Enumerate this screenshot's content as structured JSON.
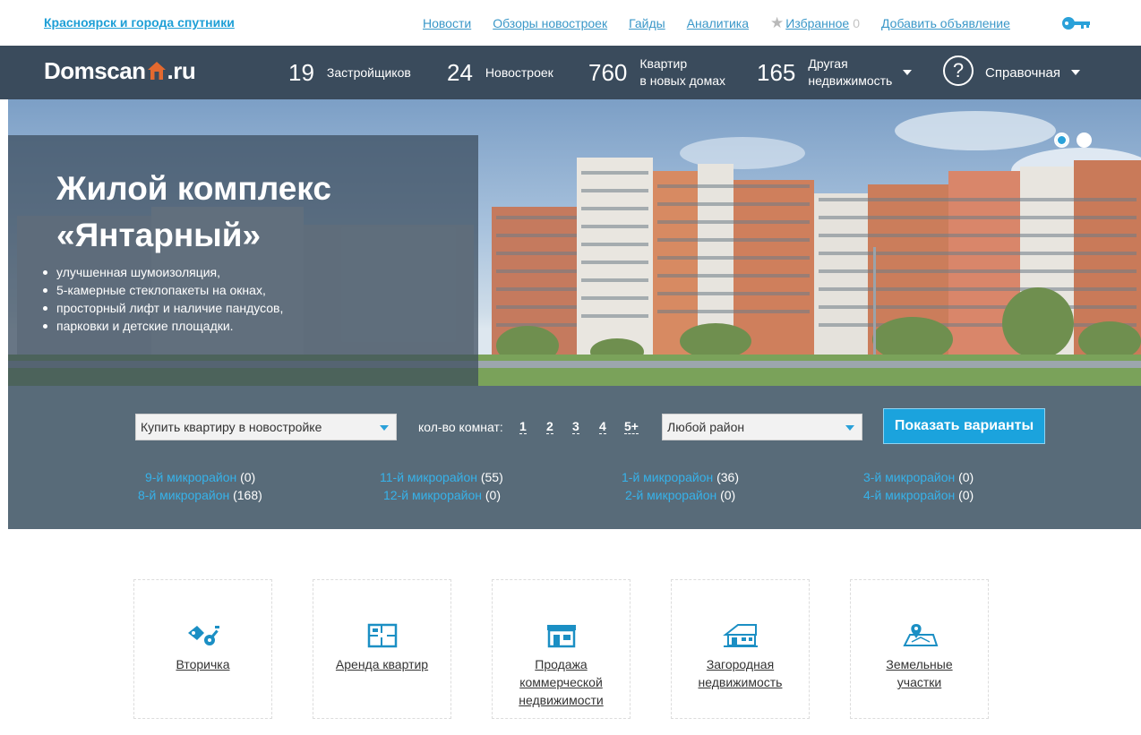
{
  "topbar": {
    "city": "Красноярск и города спутники",
    "nav": [
      "Новости",
      "Обзоры новостроек",
      "Гайды",
      "Аналитика"
    ],
    "favorites_label": "Избранное",
    "favorites_count": "0",
    "add_listing": "Добавить объявление"
  },
  "header": {
    "logo_left": "Domscan",
    "logo_right": ".ru",
    "stats": [
      {
        "num": "19",
        "label": "Застройщиков"
      },
      {
        "num": "24",
        "label": "Новостроек"
      },
      {
        "num": "760",
        "label_line1": "Квартир",
        "label_line2": "в новых домах"
      },
      {
        "num": "165",
        "label_line1": "Другая",
        "label_line2": "недвижимость"
      }
    ],
    "help_symbol": "?",
    "help_label": "Справочная"
  },
  "hero": {
    "title_line1": "Жилой комплекс",
    "title_line2": "«Янтарный»",
    "features": [
      "улучшенная шумоизоляция,",
      "5-камерные стеклопакеты на окнах,",
      "просторный лифт и наличие пандусов,",
      "парковки и детские площадки."
    ]
  },
  "search": {
    "deal_type": "Купить квартиру в новостройке",
    "rooms_label": "кол-во комнат:",
    "rooms": [
      "1",
      "2",
      "3",
      "4",
      "5+"
    ],
    "district": "Любой район",
    "submit": "Показать варианты",
    "districts": [
      {
        "name": "9-й микрорайон",
        "count": "(0)"
      },
      {
        "name": "8-й микрорайон",
        "count": "(168)"
      },
      {
        "name": "11-й микрорайон",
        "count": "(55)"
      },
      {
        "name": "12-й микрорайон",
        "count": "(0)"
      },
      {
        "name": "1-й микрорайон",
        "count": "(36)"
      },
      {
        "name": "2-й микрорайон",
        "count": "(0)"
      },
      {
        "name": "3-й микрорайон",
        "count": "(0)"
      },
      {
        "name": "4-й микрорайон",
        "count": "(0)"
      }
    ]
  },
  "categories": [
    {
      "icon": "keys-icon",
      "line1": "Вторичка",
      "line2": "",
      "line3": ""
    },
    {
      "icon": "floorplan-icon",
      "line1": "Аренда квартир",
      "line2": "",
      "line3": ""
    },
    {
      "icon": "shop-icon",
      "line1": "Продажа",
      "line2": "коммерческой",
      "line3": "недвижимости"
    },
    {
      "icon": "country-house-icon",
      "line1": "Загородная",
      "line2": "недвижимость",
      "line3": ""
    },
    {
      "icon": "land-plot-icon",
      "line1": "Земельные",
      "line2": "участки",
      "line3": ""
    }
  ],
  "colors": {
    "accent": "#1ba3dd",
    "header_bg": "#3a4b5c",
    "search_bg": "#586b79",
    "link": "#3a97c8"
  }
}
